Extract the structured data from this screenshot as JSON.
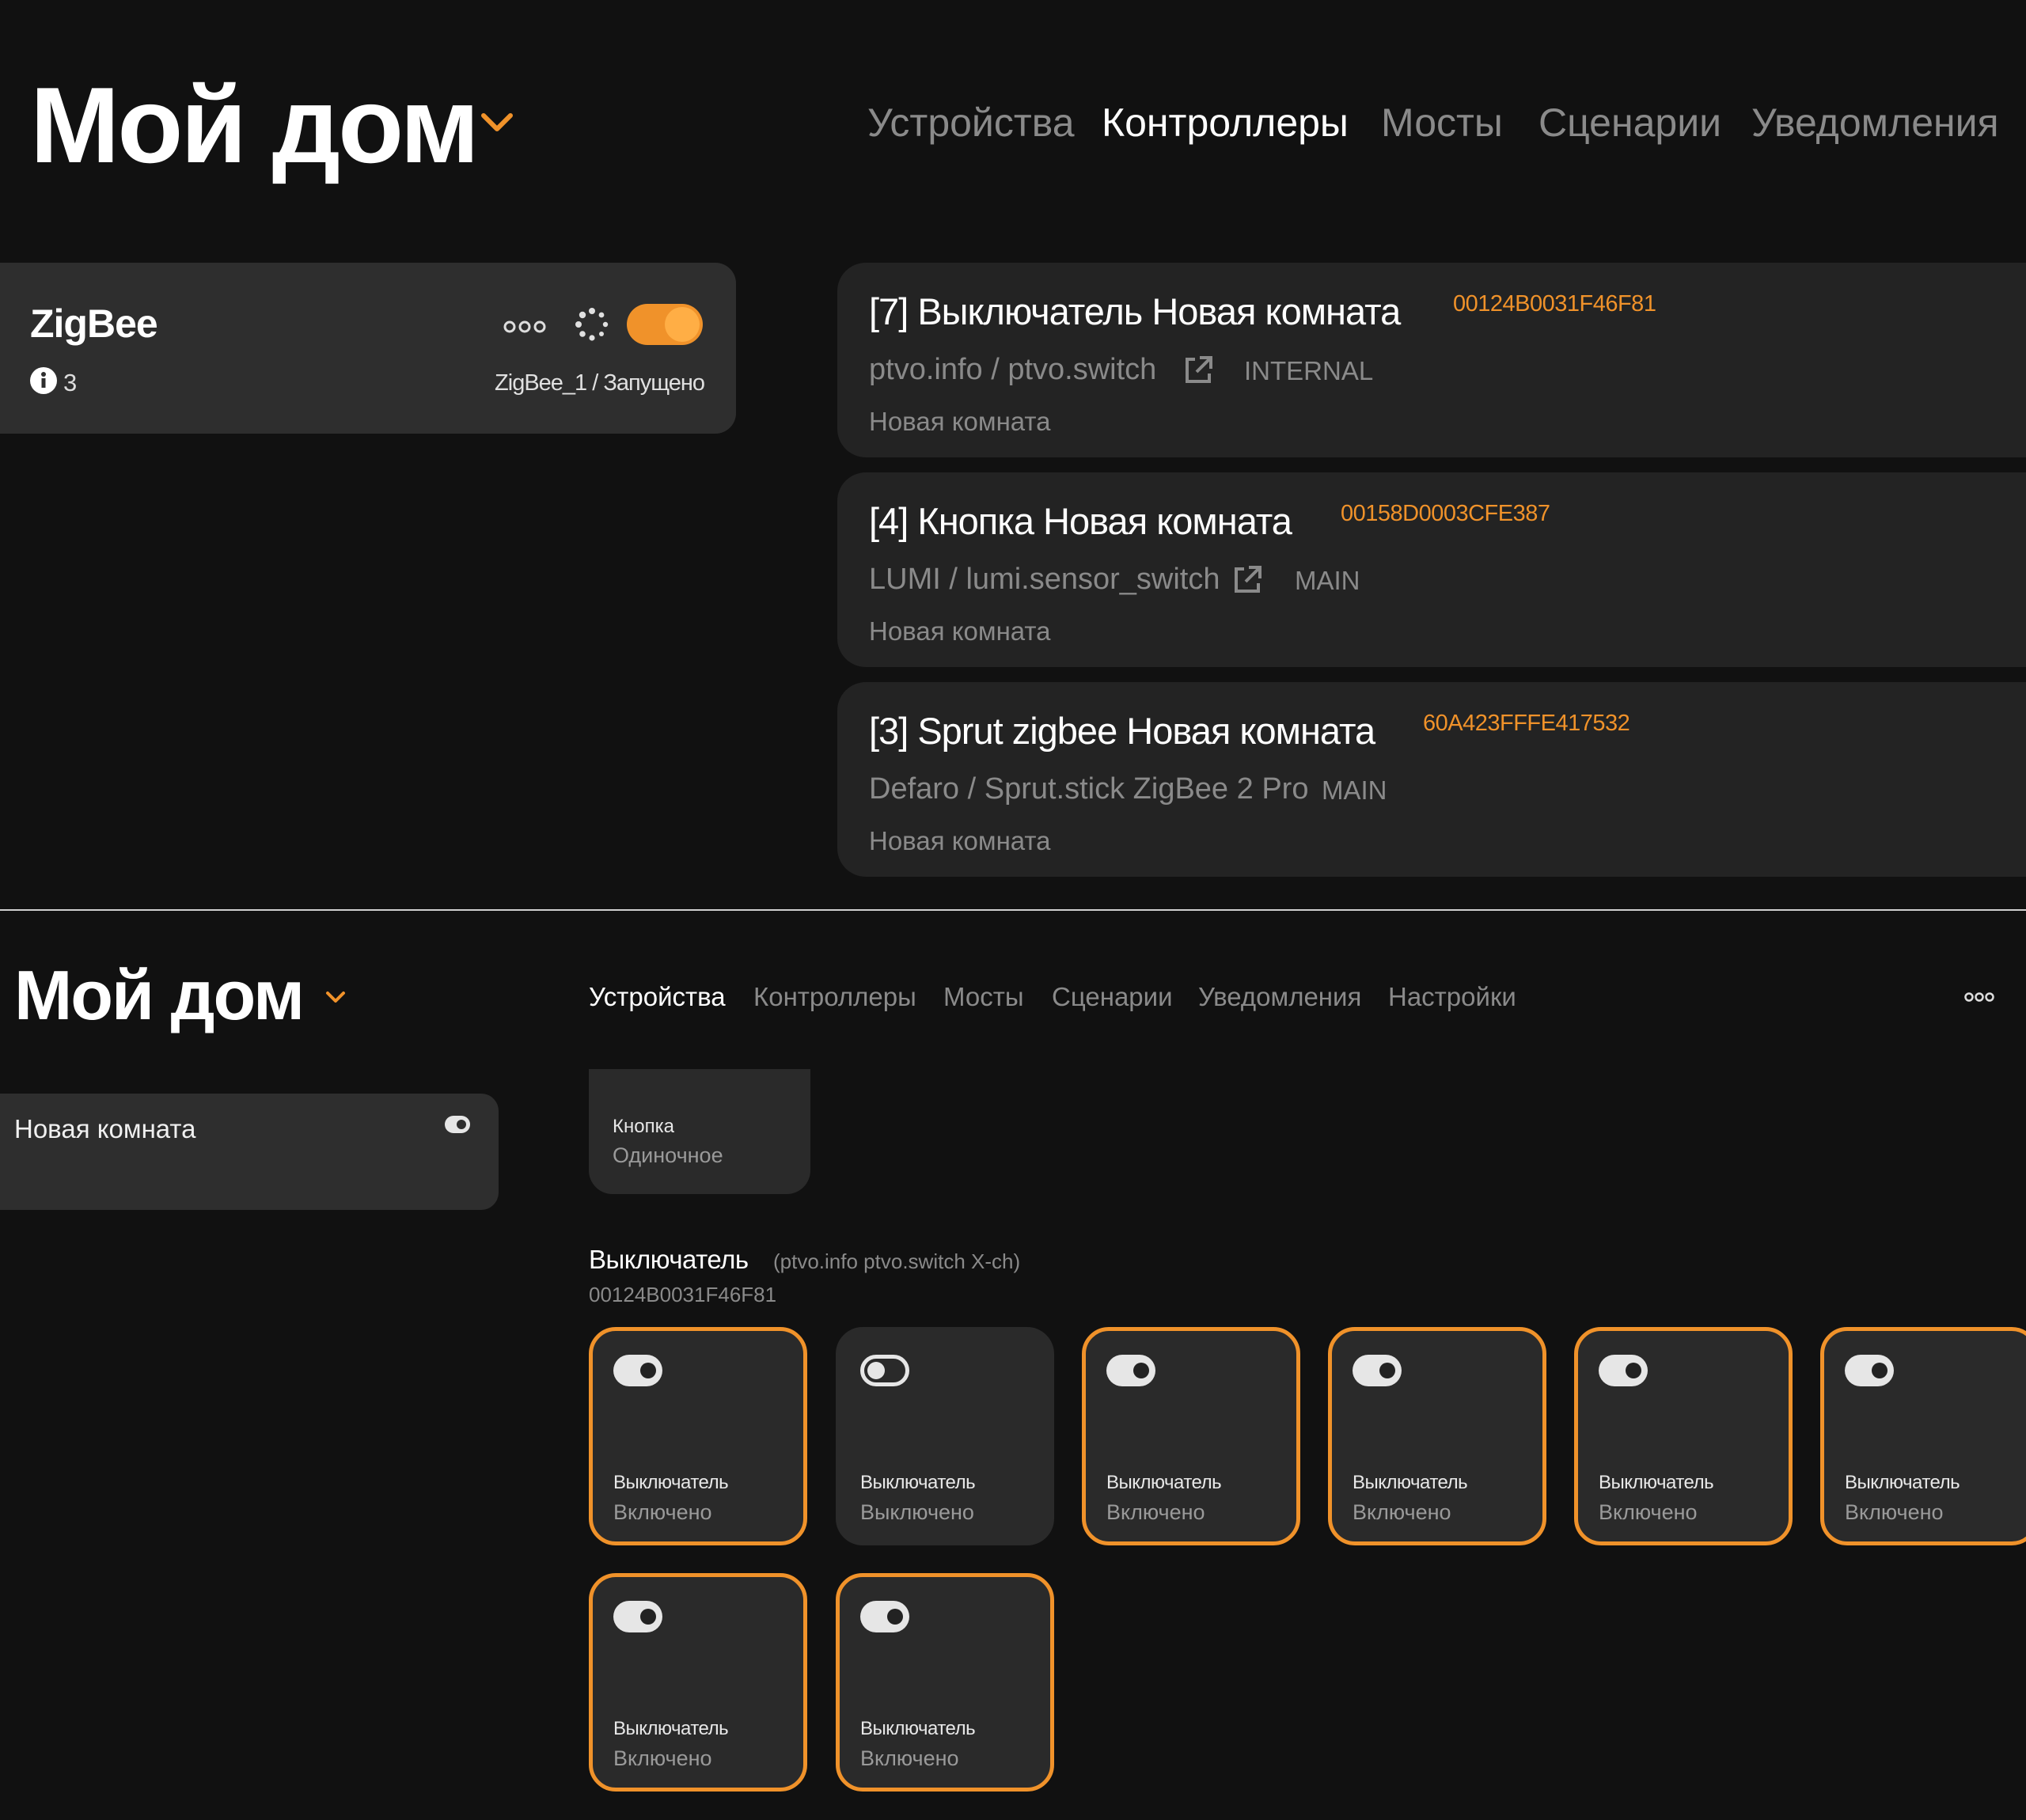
{
  "top": {
    "home_title": "Мой дом",
    "nav": [
      "Устройства",
      "Контроллеры",
      "Мосты",
      "Сценарии",
      "Уведомления"
    ],
    "nav_active": "Контроллеры",
    "controller": {
      "name": "ZigBee",
      "badge_count": "3",
      "status": "ZigBee_1 / Запущено",
      "enabled": true
    },
    "devices": [
      {
        "title": "[7] Выключатель Новая комната",
        "mac": "00124B0031F46F81",
        "model": "ptvo.info / ptvo.switch",
        "has_link": true,
        "tag": "INTERNAL",
        "room": "Новая комната"
      },
      {
        "title": "[4] Кнопка Новая комната",
        "mac": "00158D0003CFE387",
        "model": "LUMI / lumi.sensor_switch",
        "has_link": true,
        "tag": "MAIN",
        "room": "Новая комната"
      },
      {
        "title": "[3] Sprut zigbee Новая комната",
        "mac": "60A423FFFE417532",
        "model": "Defaro / Sprut.stick ZigBee 2 Pro",
        "has_link": false,
        "tag": "MAIN",
        "room": "Новая комната"
      }
    ]
  },
  "bottom": {
    "home_title": "Мой дом",
    "nav": [
      "Устройства",
      "Контроллеры",
      "Мосты",
      "Сценарии",
      "Уведомления",
      "Настройки"
    ],
    "nav_active": "Устройства",
    "room": {
      "name": "Новая комната"
    },
    "button_tile": {
      "name": "Кнопка",
      "state": "Одиночное"
    },
    "group": {
      "title": "Выключатель",
      "subtitle": "(ptvo.info ptvo.switch X-ch)",
      "mac": "00124B0031F46F81"
    },
    "tiles": [
      {
        "name": "Выключатель",
        "state": "Включено",
        "on": true
      },
      {
        "name": "Выключатель",
        "state": "Выключено",
        "on": false
      },
      {
        "name": "Выключатель",
        "state": "Включено",
        "on": true
      },
      {
        "name": "Выключатель",
        "state": "Включено",
        "on": true
      },
      {
        "name": "Выключатель",
        "state": "Включено",
        "on": true
      },
      {
        "name": "Выключатель",
        "state": "Включено",
        "on": true
      },
      {
        "name": "Выключатель",
        "state": "Включено",
        "on": true
      },
      {
        "name": "Выключатель",
        "state": "Включено",
        "on": true
      }
    ]
  },
  "colors": {
    "accent": "#f0922a",
    "background": "#111111",
    "card": "#2e2e2e",
    "muted": "#8a8a8a"
  }
}
